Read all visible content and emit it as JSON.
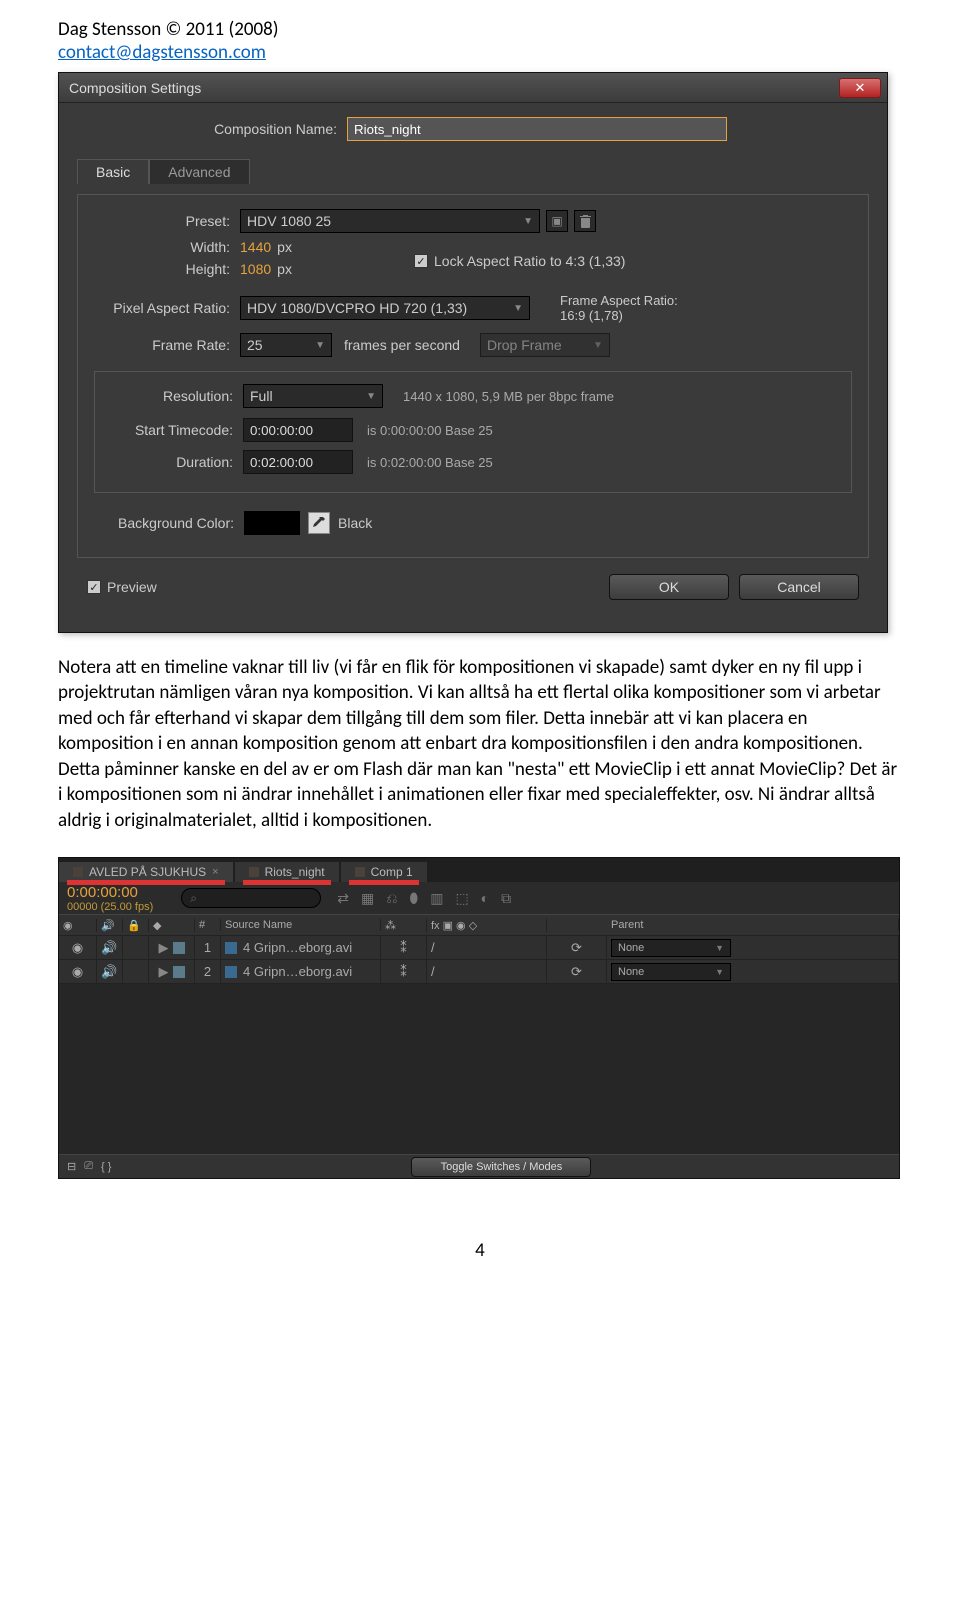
{
  "header": {
    "author_line": "Dag Stensson © 2011 (2008)",
    "email": "contact@dagstensson.com"
  },
  "dialog": {
    "title": "Composition Settings",
    "comp_name_label": "Composition Name:",
    "comp_name_value": "Riots_night",
    "tabs": {
      "basic": "Basic",
      "advanced": "Advanced"
    },
    "preset_label": "Preset:",
    "preset_value": "HDV 1080 25",
    "width_label": "Width:",
    "width_value": "1440",
    "px": "px",
    "height_label": "Height:",
    "height_value": "1080",
    "lock_aspect": "Lock Aspect Ratio to 4:3 (1,33)",
    "par_label": "Pixel Aspect Ratio:",
    "par_value": "HDV 1080/DVCPRO HD 720 (1,33)",
    "far_label": "Frame Aspect Ratio:",
    "far_value": "16:9 (1,78)",
    "fr_label": "Frame Rate:",
    "fr_value": "25",
    "fr_suffix": "frames per second",
    "drop_frame": "Drop Frame",
    "res_label": "Resolution:",
    "res_value": "Full",
    "res_info": "1440 x 1080, 5,9 MB per 8bpc frame",
    "stc_label": "Start Timecode:",
    "stc_value": "0:00:00:00",
    "stc_info": "is 0:00:00:00 Base 25",
    "dur_label": "Duration:",
    "dur_value": "0:02:00:00",
    "dur_info": "is 0:02:00:00 Base 25",
    "bg_label": "Background Color:",
    "bg_name": "Black",
    "preview": "Preview",
    "ok": "OK",
    "cancel": "Cancel"
  },
  "bodytext": "Notera att en timeline vaknar till liv (vi får en flik för kompositionen vi skapade) samt dyker en ny fil upp i projektrutan nämligen våran nya komposition. Vi kan alltså ha ett flertal olika kompositioner som vi arbetar med och får efterhand vi skapar dem tillgång till dem som filer. Detta innebär att vi kan placera en komposition i en annan komposition genom att enbart dra kompositionsfilen i den andra kompositionen. Detta påminner kanske en del av er om Flash där man kan \"nesta\" ett MovieClip i ett annat MovieClip? Det är i kompositionen som ni ändrar innehållet i animationen eller fixar med specialeffekter, osv. Ni ändrar alltså aldrig i originalmaterialet, alltid i kompositionen.",
  "timeline": {
    "tabs": [
      "AVLED PÅ SJUKHUS",
      "Riots_night",
      "Comp 1"
    ],
    "timecode": "0:00:00:00",
    "fps": "00000 (25.00 fps)",
    "col_num": "#",
    "col_src": "Source Name",
    "col_parent": "Parent",
    "rows": [
      {
        "n": "1",
        "name": "4 Gripn…eborg.avi",
        "parent": "None"
      },
      {
        "n": "2",
        "name": "4 Gripn…eborg.avi",
        "parent": "None"
      }
    ],
    "toggle": "Toggle Switches / Modes"
  },
  "page_number": "4"
}
